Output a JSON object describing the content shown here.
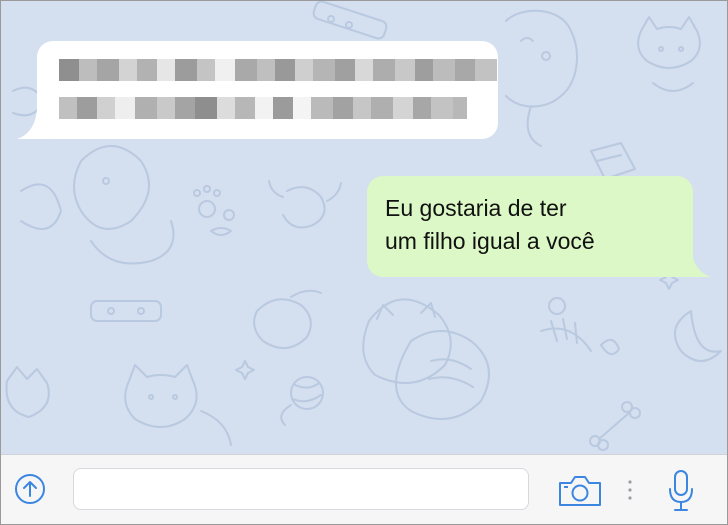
{
  "conversation": {
    "incoming_message": {
      "blurred": true
    },
    "outgoing_message": {
      "line1": "Eu gostaria de ter",
      "line2": "um filho igual a você"
    }
  },
  "input_bar": {
    "text_value": "",
    "send_icon": "arrow-up-circle-icon",
    "camera_icon": "camera-icon",
    "more_icon": "vertical-dots-icon",
    "mic_icon": "microphone-icon"
  },
  "colors": {
    "chat_background": "#d4dfef",
    "doodle_stroke": "#b9c9e0",
    "incoming_bubble": "#ffffff",
    "outgoing_bubble": "#dcf8c6",
    "accent": "#3b86e0"
  }
}
